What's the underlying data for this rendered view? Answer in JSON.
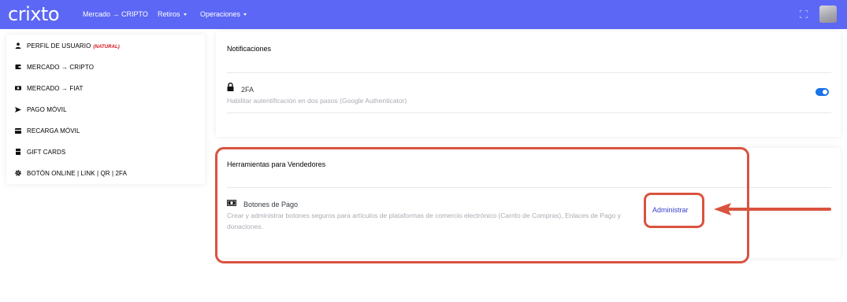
{
  "navbar": {
    "logo": "crixto",
    "links": [
      {
        "label": "Mercado → CRIPTO"
      },
      {
        "label": "Retiros"
      },
      {
        "label": "Operaciones"
      }
    ],
    "background_color": "#5c67f5"
  },
  "sidebar": {
    "items": [
      {
        "label": "PERFIL DE USUARIO",
        "tag": "(NATURAL)",
        "icon": "user-icon"
      },
      {
        "label": "MERCADO → CRIPTO",
        "icon": "wallet-icon"
      },
      {
        "label": "MERCADO → FIAT",
        "icon": "money-icon"
      },
      {
        "label": "PAGO MÓVIL",
        "icon": "send-icon"
      },
      {
        "label": "RECARGA MÓVIL",
        "icon": "card-icon"
      },
      {
        "label": "GIFT CARDS",
        "icon": "gift-icon"
      },
      {
        "label": "BOTÓN ONLINE | LINK | QR | 2FA",
        "icon": "gear-icon"
      }
    ]
  },
  "notifications": {
    "title": "Notificaciones",
    "twofa": {
      "title": "2FA",
      "description": "Habilitar autentificación en dos pasos (Google Authenticator)",
      "enabled": true
    }
  },
  "tools": {
    "title": "Herramientas para Vendedores",
    "payment_buttons": {
      "title": "Botones de Pago",
      "description_line1": "Crear y administrar botones seguros para artículos de plataformas de comercio electrónico (Carrito de Compras), Enlaces de Pago y",
      "description_line2": "donaciones.",
      "action_label": "Administrar"
    }
  },
  "colors": {
    "accent": "#5c67f5",
    "toggle_on": "#1a73e8",
    "annotation": "#d9533f",
    "tag_red": "#d6101b"
  }
}
